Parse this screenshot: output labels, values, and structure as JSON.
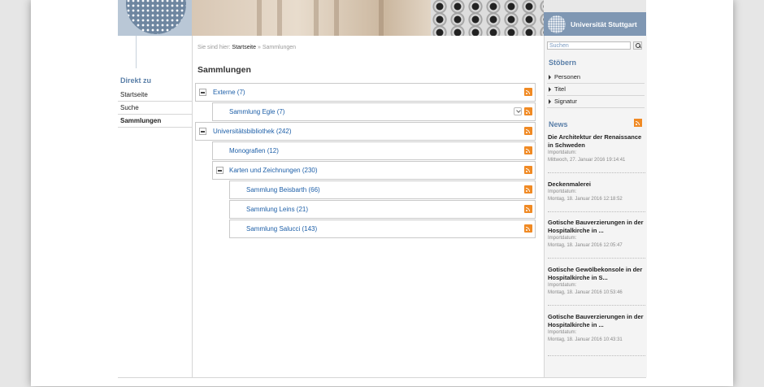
{
  "header": {
    "logo_text": "Universität Stuttgart"
  },
  "left_nav": {
    "title": "Direkt zu",
    "items": [
      {
        "label": "Startseite",
        "active": false
      },
      {
        "label": "Suche",
        "active": false
      },
      {
        "label": "Sammlungen",
        "active": true
      }
    ]
  },
  "breadcrumb": {
    "prefix": "Sie sind hier:",
    "home": "Startseite",
    "separator": "»",
    "current": "Sammlungen"
  },
  "main": {
    "title": "Sammlungen",
    "tree": [
      {
        "label": "Externe (7)",
        "toggle": true
      },
      {
        "label": "Sammlung Egle (7)",
        "toggle": false,
        "dropdown": true
      },
      {
        "label": "Universitätsbibliothek (242)",
        "toggle": true
      },
      {
        "label": "Monografien (12)",
        "toggle": false
      },
      {
        "label": "Karten und Zeichnungen (230)",
        "toggle": true
      },
      {
        "label": "Sammlung Beisbarth (66)",
        "toggle": false
      },
      {
        "label": "Sammlung Leins (21)",
        "toggle": false
      },
      {
        "label": "Sammlung Salucci (143)",
        "toggle": false
      }
    ]
  },
  "sidebar": {
    "search_placeholder": "Suchen",
    "browse_title": "Stöbern",
    "browse_items": [
      "Personen",
      "Titel",
      "Signatur"
    ],
    "news_title": "News",
    "news": [
      {
        "title": "Die Architektur der Renaissance in Schweden",
        "label": "Importdatum:",
        "date": "Mittwoch, 27. Januar 2016 19:14:41"
      },
      {
        "title": "Deckenmalerei",
        "label": "Importdatum:",
        "date": "Montag, 18. Januar 2016 12:18:52"
      },
      {
        "title": "Gotische Bauverzierungen in der Hospitalkirche in ...",
        "label": "Importdatum:",
        "date": "Montag, 18. Januar 2016 12:05:47"
      },
      {
        "title": "Gotische Gewölbekonsole in der Hospitalkirche in S...",
        "label": "Importdatum:",
        "date": "Montag, 18. Januar 2016 10:53:46"
      },
      {
        "title": "Gotische Bauverzierungen in der Hospitalkirche in ...",
        "label": "Importdatum:",
        "date": "Montag, 18. Januar 2016 10:43:31"
      }
    ]
  },
  "colors": {
    "link": "#1d5fa8",
    "heading_blue": "#5a7fa8",
    "rss": "#f08a24",
    "logo_bg": "#7f97b3"
  },
  "icons": [
    "seal-icon",
    "rss-icon",
    "minus-toggle-icon",
    "chevron-down-icon",
    "search-icon",
    "triangle-right-icon"
  ]
}
